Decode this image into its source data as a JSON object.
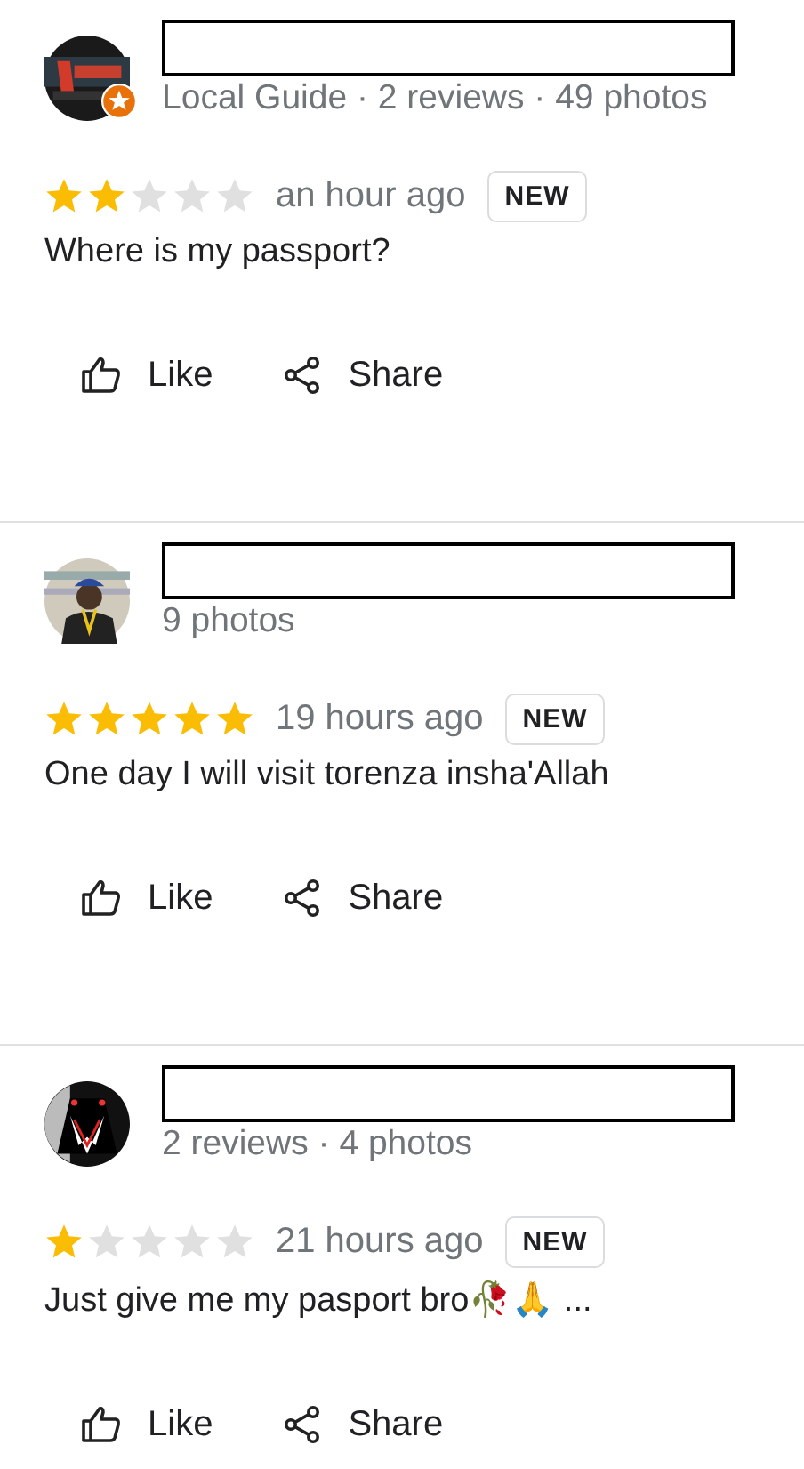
{
  "reviews": [
    {
      "local_guide": true,
      "meta": "Local Guide · 2 reviews · 49 photos",
      "stars": 2,
      "time": "an hour ago",
      "badge": "NEW",
      "text": "Where is my passport?",
      "actions": [
        "Like",
        "Share"
      ]
    },
    {
      "local_guide": false,
      "meta": "9 photos",
      "stars": 5,
      "time": "19 hours ago",
      "badge": "NEW",
      "text": "One day I will visit torenza insha'Allah",
      "actions": [
        "Like",
        "Share"
      ]
    },
    {
      "local_guide": false,
      "meta": "2 reviews · 4 photos",
      "stars": 1,
      "time": "21 hours ago",
      "badge": "NEW",
      "text": "Just give me my pasport bro🥀🙏 ...",
      "actions": [
        "Like",
        "Share"
      ]
    }
  ]
}
